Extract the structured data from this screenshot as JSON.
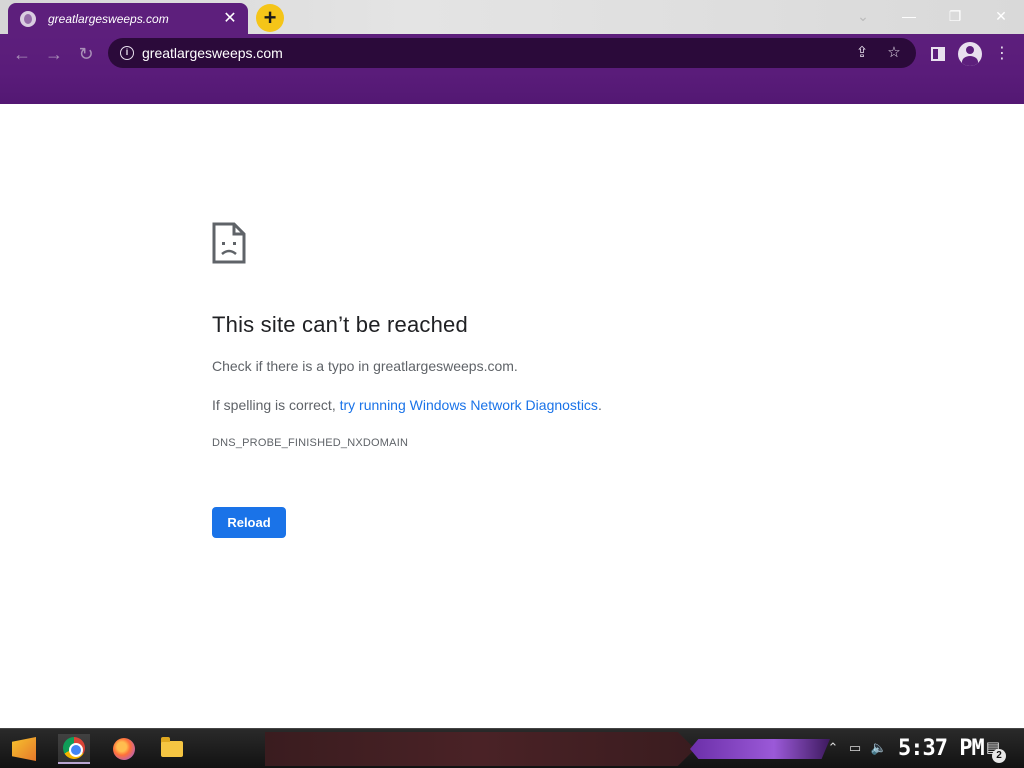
{
  "browser": {
    "tab": {
      "title": "greatlargesweeps.com",
      "close_glyph": "✕",
      "favicon": "globe-icon"
    },
    "new_tab_glyph": "+",
    "window_controls": {
      "dropdown": "⌄",
      "minimize": "—",
      "restore": "❐",
      "close": "✕"
    },
    "nav": {
      "back": "←",
      "forward": "→",
      "reload": "↻"
    },
    "omnibox": {
      "info_glyph": "i",
      "url": "greatlargesweeps.com",
      "share_glyph": "⇪",
      "bookmark_glyph": "☆"
    },
    "menu_glyph": "⋮"
  },
  "error_page": {
    "icon": "sad-page-icon",
    "title": "This site can’t be reached",
    "line1": "Check if there is a typo in greatlargesweeps.com.",
    "line2_prefix": "If spelling is correct, ",
    "line2_link": "try running Windows Network Diagnostics",
    "line2_suffix": ".",
    "error_code": "DNS_PROBE_FINISHED_NXDOMAIN",
    "reload_label": "Reload"
  },
  "taskbar": {
    "apps": [
      "start-icon",
      "chrome-icon",
      "firefox-icon",
      "file-explorer-icon"
    ],
    "tray": {
      "chevron": "⌃",
      "network": "▭",
      "volume": "🔈"
    },
    "clock": "5:37 PM",
    "notifications_glyph": "▤",
    "notification_count": "2"
  },
  "colors": {
    "theme_purple": "#5d1f7c",
    "omnibox_bg": "#2b0a3a",
    "reload_button": "#1a73e8",
    "link": "#1a73e8"
  }
}
